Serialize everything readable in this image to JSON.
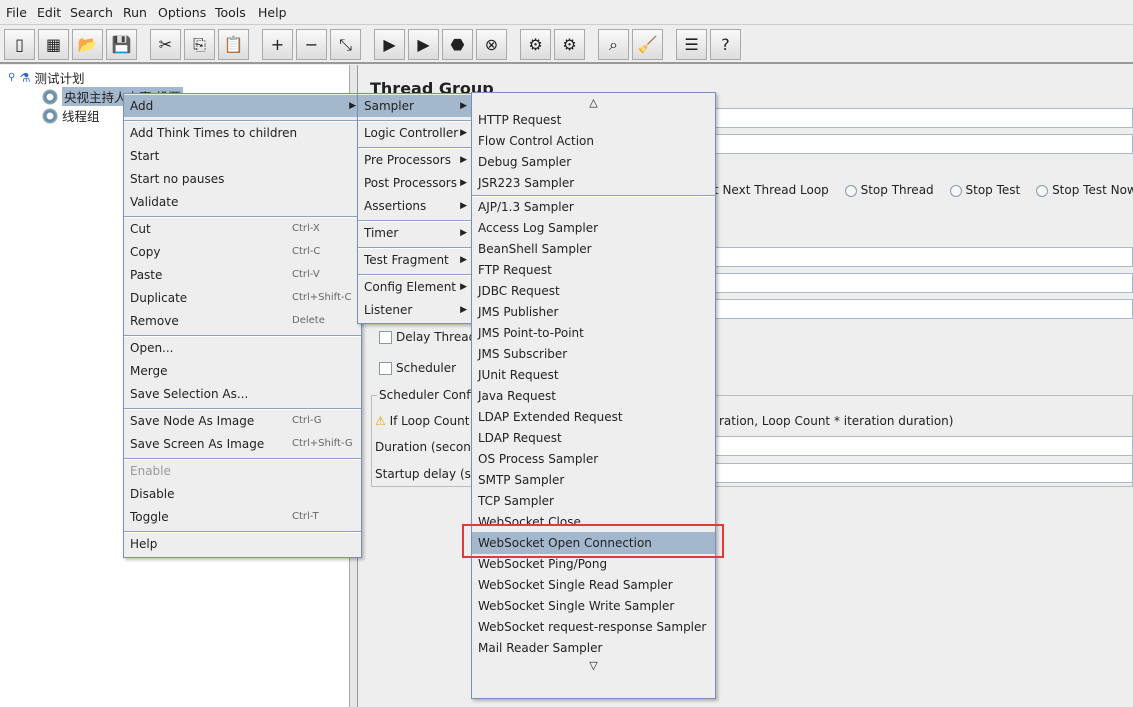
{
  "menubar": [
    "File",
    "Edit",
    "Search",
    "Run",
    "Options",
    "Tools",
    "Help"
  ],
  "toolbar": [
    {
      "icon": "new-icon",
      "g": "▯"
    },
    {
      "icon": "templates-icon",
      "g": "▦"
    },
    {
      "icon": "open-icon",
      "g": "📂"
    },
    {
      "icon": "save-icon",
      "g": "💾"
    },
    {
      "icon": "cut-icon",
      "g": "✂"
    },
    {
      "icon": "copy-icon",
      "g": "⎘"
    },
    {
      "icon": "paste-icon",
      "g": "📋"
    },
    {
      "icon": "expand-icon",
      "g": "+"
    },
    {
      "icon": "collapse-icon",
      "g": "−"
    },
    {
      "icon": "toggle-icon",
      "g": "⤡"
    },
    {
      "icon": "start-icon",
      "g": "▶"
    },
    {
      "icon": "start-no-pauses-icon",
      "g": "▶"
    },
    {
      "icon": "stop-icon",
      "g": "⬣"
    },
    {
      "icon": "shutdown-icon",
      "g": "⊗"
    },
    {
      "icon": "clear-icon",
      "g": "⚙"
    },
    {
      "icon": "clear-all-icon",
      "g": "⚙"
    },
    {
      "icon": "search-icon",
      "g": "⌕"
    },
    {
      "icon": "reset-search-icon",
      "g": "🧹"
    },
    {
      "icon": "function-helper-icon",
      "g": "☰"
    },
    {
      "icon": "help-icon",
      "g": "?"
    }
  ],
  "tree": {
    "root": "测试计划",
    "children": [
      "央视主持人大赛-投票",
      "线程组"
    ]
  },
  "panel": {
    "title": "Thread Group",
    "radio_partial": "rt Next Thread Loop",
    "radios": [
      "Stop Thread",
      "Stop Test",
      "Stop Test Now"
    ],
    "delay_thread": "Delay Thread",
    "scheduler": "Scheduler",
    "scheduler_config": "Scheduler Config",
    "warning": "If Loop Count",
    "warning_tail": "ration, Loop Count * iteration duration)",
    "duration": "Duration (second",
    "startup": "Startup delay (se"
  },
  "context_menu": [
    {
      "label": "Add",
      "arrow": true,
      "hl": true
    },
    {
      "sep": true
    },
    {
      "label": "Add Think Times to children"
    },
    {
      "label": "Start"
    },
    {
      "label": "Start no pauses"
    },
    {
      "label": "Validate"
    },
    {
      "sep": true
    },
    {
      "label": "Cut",
      "sc": "Ctrl-X"
    },
    {
      "label": "Copy",
      "sc": "Ctrl-C"
    },
    {
      "label": "Paste",
      "sc": "Ctrl-V"
    },
    {
      "label": "Duplicate",
      "sc": "Ctrl+Shift-C"
    },
    {
      "label": "Remove",
      "sc": "Delete"
    },
    {
      "sep": true
    },
    {
      "label": "Open..."
    },
    {
      "label": "Merge"
    },
    {
      "label": "Save Selection As..."
    },
    {
      "sep": true
    },
    {
      "label": "Save Node As Image",
      "sc": "Ctrl-G"
    },
    {
      "label": "Save Screen As Image",
      "sc": "Ctrl+Shift-G"
    },
    {
      "sep": true
    },
    {
      "label": "Enable",
      "dis": true
    },
    {
      "label": "Disable"
    },
    {
      "label": "Toggle",
      "sc": "Ctrl-T"
    },
    {
      "sep": true
    },
    {
      "label": "Help"
    }
  ],
  "add_menu": [
    {
      "label": "Sampler",
      "arrow": true,
      "hl": true
    },
    {
      "sep": true
    },
    {
      "label": "Logic Controller",
      "arrow": true
    },
    {
      "sep": true
    },
    {
      "label": "Pre Processors",
      "arrow": true
    },
    {
      "label": "Post Processors",
      "arrow": true
    },
    {
      "label": "Assertions",
      "arrow": true
    },
    {
      "sep": true
    },
    {
      "label": "Timer",
      "arrow": true
    },
    {
      "sep": true
    },
    {
      "label": "Test Fragment",
      "arrow": true
    },
    {
      "sep": true
    },
    {
      "label": "Config Element",
      "arrow": true
    },
    {
      "label": "Listener",
      "arrow": true
    }
  ],
  "sampler_menu": {
    "scroll_up": "△",
    "scroll_down": "▽",
    "items": [
      {
        "label": "HTTP Request"
      },
      {
        "label": "Flow Control Action"
      },
      {
        "label": "Debug Sampler"
      },
      {
        "label": "JSR223 Sampler"
      },
      {
        "sep": true
      },
      {
        "label": "AJP/1.3 Sampler"
      },
      {
        "label": "Access Log Sampler"
      },
      {
        "label": "BeanShell Sampler"
      },
      {
        "label": "FTP Request"
      },
      {
        "label": "JDBC Request"
      },
      {
        "label": "JMS Publisher"
      },
      {
        "label": "JMS Point-to-Point"
      },
      {
        "label": "JMS Subscriber"
      },
      {
        "label": "JUnit Request"
      },
      {
        "label": "Java Request"
      },
      {
        "label": "LDAP Extended Request"
      },
      {
        "label": "LDAP Request"
      },
      {
        "label": "OS Process Sampler"
      },
      {
        "label": "SMTP Sampler"
      },
      {
        "label": "TCP Sampler"
      },
      {
        "label": "WebSocket Close"
      },
      {
        "label": "WebSocket Open Connection",
        "hl": true
      },
      {
        "label": "WebSocket Ping/Pong"
      },
      {
        "label": "WebSocket Single Read Sampler"
      },
      {
        "label": "WebSocket Single Write Sampler"
      },
      {
        "label": "WebSocket request-response Sampler"
      },
      {
        "label": "Mail Reader Sampler"
      }
    ]
  },
  "colors": {
    "highlight": "#a3b8cc",
    "annotation_box": "#e53935"
  }
}
